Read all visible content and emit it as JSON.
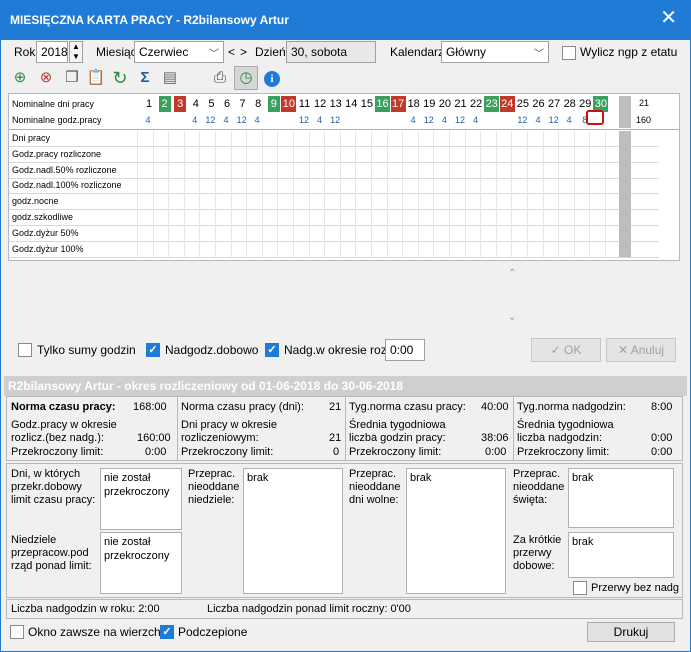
{
  "window": {
    "title": "MIESIĘCZNA KARTA PRACY - R2bilansowy Artur"
  },
  "controls": {
    "rok_label": "Rok",
    "rok_value": "2018",
    "miesiac_label": "Miesiąc",
    "miesiac_value": "Czerwiec",
    "nav_prev": "<",
    "nav_next": ">",
    "dzien_label": "Dzień",
    "dzien_value": "30, sobota",
    "kalendarz_label": "Kalendarz",
    "kalendarz_value": "Główny",
    "wylicz_label": "Wylicz ngp z etatu"
  },
  "calendar": {
    "row_days_label": "Nominalne dni pracy",
    "row_hours_label": "Nominalne godz.pracy",
    "days": [
      {
        "n": "1",
        "c": ""
      },
      {
        "n": "2",
        "c": "green"
      },
      {
        "n": "3",
        "c": "red"
      },
      {
        "n": "4",
        "c": ""
      },
      {
        "n": "5",
        "c": ""
      },
      {
        "n": "6",
        "c": ""
      },
      {
        "n": "7",
        "c": ""
      },
      {
        "n": "8",
        "c": ""
      },
      {
        "n": "9",
        "c": "green"
      },
      {
        "n": "10",
        "c": "red"
      },
      {
        "n": "11",
        "c": ""
      },
      {
        "n": "12",
        "c": ""
      },
      {
        "n": "13",
        "c": ""
      },
      {
        "n": "14",
        "c": ""
      },
      {
        "n": "15",
        "c": ""
      },
      {
        "n": "16",
        "c": "green"
      },
      {
        "n": "17",
        "c": "red"
      },
      {
        "n": "18",
        "c": ""
      },
      {
        "n": "19",
        "c": ""
      },
      {
        "n": "20",
        "c": ""
      },
      {
        "n": "21",
        "c": ""
      },
      {
        "n": "22",
        "c": ""
      },
      {
        "n": "23",
        "c": "green"
      },
      {
        "n": "24",
        "c": "red"
      },
      {
        "n": "25",
        "c": ""
      },
      {
        "n": "26",
        "c": ""
      },
      {
        "n": "27",
        "c": ""
      },
      {
        "n": "28",
        "c": ""
      },
      {
        "n": "29",
        "c": ""
      },
      {
        "n": "30",
        "c": "green"
      }
    ],
    "hours": [
      "4",
      "",
      "",
      "4",
      "12",
      "4",
      "12",
      "4",
      "",
      "",
      "12",
      "4",
      "12",
      "",
      "",
      "",
      "",
      "4",
      "12",
      "4",
      "12",
      "4",
      "",
      "",
      "12",
      "4",
      "12",
      "4",
      "8",
      ""
    ],
    "total_days": "21",
    "total_hours": "160",
    "row_labels": [
      "Dni pracy",
      "Godz.pracy rozliczone",
      "Godz.nadl.50% rozliczone",
      "Godz.nadl.100% rozliczone",
      "godz.nocne",
      "godz.szkodliwe",
      "Godz.dyżur 50%",
      "Godz.dyżur 100%"
    ]
  },
  "options": {
    "tylko_sumy": "Tylko sumy godzin",
    "nadgodz_dobowo": "Nadgodz.dobowo",
    "nadg_okres": "Nadg.w okresie rozl.",
    "nadg_okres_value": "0:00",
    "ok": "OK",
    "anuluj": "Anuluj"
  },
  "summary": {
    "header": "R2bilansowy Artur - okres rozliczeniowy od 01-06-2018 do 30-06-2018",
    "col1": {
      "norma_label": "Norma czasu pracy:",
      "norma_value": "168:00",
      "godz_label": "Godz.pracy w okresie rozlicz.(bez nadg.):",
      "godz_value": "160:00",
      "przekr_label": "Przekroczony limit:",
      "przekr_value": "0:00"
    },
    "col2": {
      "norma_label": "Norma czasu pracy (dni):",
      "norma_value": "21",
      "dni_label": "Dni pracy w okresie rozliczeniowym:",
      "dni_value": "21",
      "przekr_label": "Przekroczony limit:",
      "przekr_value": "0"
    },
    "col3": {
      "tyg_label": "Tyg.norma czasu pracy:",
      "tyg_value": "40:00",
      "sred_label": "Średnia tygodniowa liczba godzin pracy:",
      "sred_value": "38:06",
      "przekr_label": "Przekroczony limit:",
      "przekr_value": "0:00"
    },
    "col4": {
      "tyg_label": "Tyg.norma nadgodzin:",
      "tyg_value": "8:00",
      "sred_label": "Średnia tygodniowa liczba nadgodzin:",
      "sred_value": "0:00",
      "przekr_label": "Przekroczony limit:",
      "przekr_value": "0:00"
    },
    "dni_dobowy_label": "Dni, w których przekr.dobowy limit czasu pracy:",
    "dni_dobowy_value": "nie został przekroczony",
    "niedziele_label": "Niedziele przepracow.pod rząd ponad limit:",
    "niedziele_value": "nie został przekroczony",
    "nieodd_niedziele_label": "Przeprac. nieoddane niedziele:",
    "nieodd_niedziele_value": "brak",
    "nieodd_dni_label": "Przeprac. nieoddane dni wolne:",
    "nieodd_dni_value": "brak",
    "nieodd_swieta_label": "Przeprac. nieoddane święta:",
    "nieodd_swieta_value": "brak",
    "za_krotkie_label": "Za krótkie przerwy dobowe:",
    "za_krotkie_value": "brak",
    "przerwy_bez_label": "Przerwy bez nadg",
    "nadg_rok": "Liczba nadgodzin w roku: 2:00",
    "nadg_limit": "Liczba nadgodzin ponad limit roczny: 0'00"
  },
  "footer": {
    "okno_label": "Okno zawsze na wierzchu",
    "podczepione_label": "Podczepione",
    "drukuj": "Drukuj"
  }
}
